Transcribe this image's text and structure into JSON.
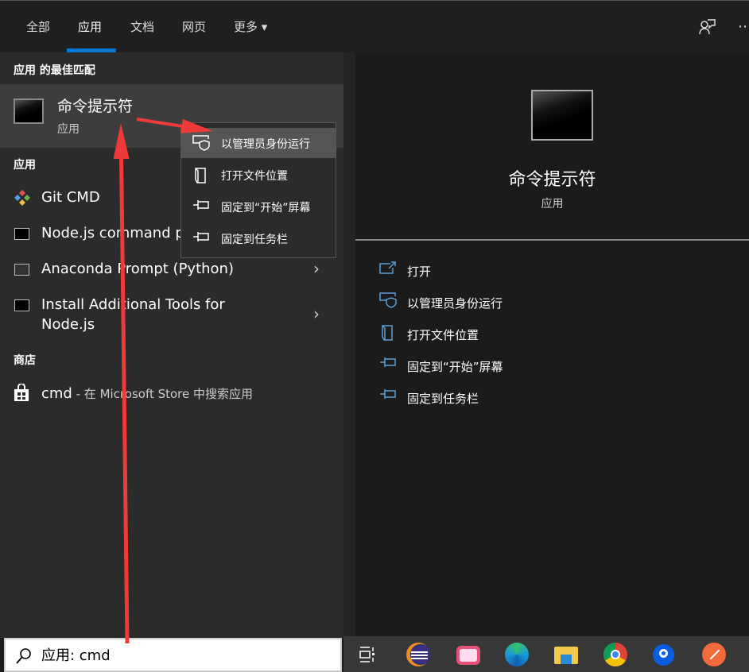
{
  "tabs": [
    {
      "label": "全部"
    },
    {
      "label": "应用",
      "active": true
    },
    {
      "label": "文档"
    },
    {
      "label": "网页"
    },
    {
      "label": "更多 ▾"
    }
  ],
  "best_match": {
    "heading": "应用 的最佳匹配",
    "title": "命令提示符",
    "subtitle": "应用"
  },
  "apps": {
    "heading": "应用",
    "items": [
      {
        "label": "Git CMD",
        "icon": "git-icon"
      },
      {
        "label": "Node.js command p",
        "icon": "terminal-icon"
      },
      {
        "label": "Anaconda Prompt (Python)",
        "icon": "terminal-icon",
        "chevron": "›"
      },
      {
        "label": "Install Additional Tools for",
        "label2": "Node.js",
        "icon": "terminal-icon",
        "chevron": "›"
      }
    ]
  },
  "store": {
    "heading": "商店",
    "query": "cmd",
    "suffix": " - 在 Microsoft Store 中搜索应用"
  },
  "context_menu": [
    {
      "label": "以管理员身份运行",
      "icon": "shield-icon"
    },
    {
      "label": "打开文件位置",
      "icon": "folder-icon"
    },
    {
      "label": "固定到“开始”屏幕",
      "icon": "pin-icon"
    },
    {
      "label": "固定到任务栏",
      "icon": "pin-icon"
    }
  ],
  "preview": {
    "title": "命令提示符",
    "subtitle": "应用",
    "actions": [
      {
        "label": "打开",
        "icon": "open-icon"
      },
      {
        "label": "以管理员身份运行",
        "icon": "shield-icon"
      },
      {
        "label": "打开文件位置",
        "icon": "folder-icon"
      },
      {
        "label": "固定到“开始”屏幕",
        "icon": "pin-icon"
      },
      {
        "label": "固定到任务栏",
        "icon": "pin-icon"
      }
    ]
  },
  "search": {
    "value": "应用: cmd"
  },
  "taskbar": [
    "task-view",
    "eclipse",
    "bilibili-tv",
    "edge",
    "file-explorer",
    "chrome",
    "app-blue",
    "postman"
  ],
  "colors": {
    "accent": "#0078d7",
    "icon_blue": "#5aa0d8",
    "annotation": "#f03a3a"
  }
}
